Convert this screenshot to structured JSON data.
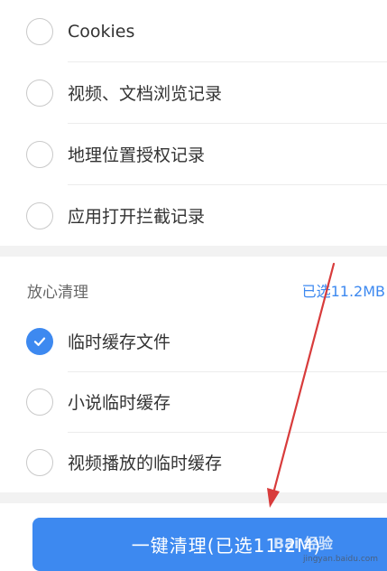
{
  "browsing_items": [
    {
      "label": "Cookies",
      "checked": false
    },
    {
      "label": "视频、文档浏览记录",
      "checked": false
    },
    {
      "label": "地理位置授权记录",
      "checked": false
    },
    {
      "label": "应用打开拦截记录",
      "checked": false
    }
  ],
  "safe_clean": {
    "title": "放心清理",
    "selected_size": "已选11.2MB",
    "items": [
      {
        "label": "临时缓存文件",
        "checked": true
      },
      {
        "label": "小说临时缓存",
        "checked": false
      },
      {
        "label": "视频播放的临时缓存",
        "checked": false
      }
    ]
  },
  "action_button": {
    "label": "一键清理(已选11.2M)"
  },
  "watermark": {
    "text": "Bai 经验",
    "url": "jingyan.baidu.com"
  },
  "colors": {
    "accent": "#3d89f0",
    "annotation_arrow": "#d83b3b"
  }
}
